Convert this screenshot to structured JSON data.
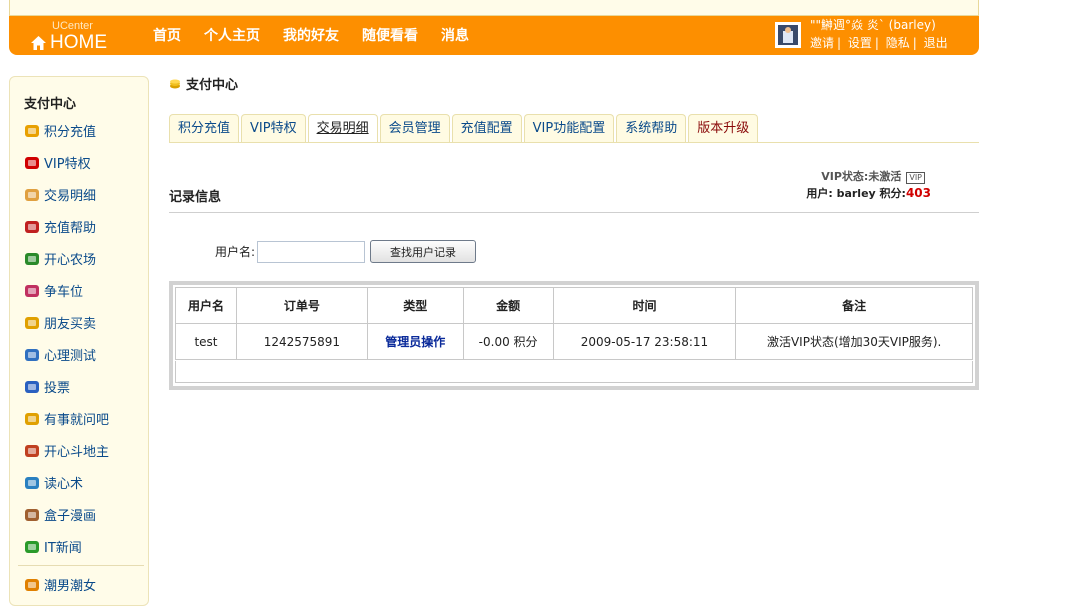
{
  "header": {
    "logo_top": "UCenter",
    "logo_main": "HOME",
    "nav": [
      "首页",
      "个人主页",
      "我的好友",
      "随便看看",
      "消息"
    ],
    "user_display": "\"\"鰰週°焱 炎` (barley)",
    "user_links": [
      "邀请",
      "设置",
      "隐私",
      "退出"
    ]
  },
  "sidebar": {
    "title": "支付中心",
    "items": [
      {
        "label": "积分充值",
        "icon": "coins-icon",
        "color": "#e8a000"
      },
      {
        "label": "VIP特权",
        "icon": "vip-icon",
        "color": "#d00000"
      },
      {
        "label": "交易明细",
        "icon": "list-icon",
        "color": "#e0a040"
      },
      {
        "label": "充值帮助",
        "icon": "help-icon",
        "color": "#c02020"
      },
      {
        "label": "开心农场",
        "icon": "sprout-icon",
        "color": "#2a8a2a"
      },
      {
        "label": "争车位",
        "icon": "car-icon",
        "color": "#c03060"
      },
      {
        "label": "朋友买卖",
        "icon": "money-icon",
        "color": "#e0a000"
      },
      {
        "label": "心理测试",
        "icon": "flask-icon",
        "color": "#3070c0"
      },
      {
        "label": "投票",
        "icon": "chart-icon",
        "color": "#2a60c0"
      },
      {
        "label": "有事就问吧",
        "icon": "question-icon",
        "color": "#e0a000"
      },
      {
        "label": "开心斗地主",
        "icon": "cards-icon",
        "color": "#c04020"
      },
      {
        "label": "读心术",
        "icon": "globe-icon",
        "color": "#2a80c0"
      },
      {
        "label": "盒子漫画",
        "icon": "box-icon",
        "color": "#a06030"
      },
      {
        "label": "IT新闻",
        "icon": "news-icon",
        "color": "#2a9a2a"
      },
      {
        "label": "潮男潮女",
        "icon": "people-icon",
        "color": "#e08000"
      }
    ]
  },
  "main": {
    "title": "支付中心",
    "tabs": [
      "积分充值",
      "VIP特权",
      "交易明细",
      "会员管理",
      "充值配置",
      "VIP功能配置",
      "系统帮助",
      "版本升级"
    ],
    "active_tab": "交易明细",
    "vip_status": "VIP状态:未激活",
    "vip_badge": "VIP",
    "user_label": "用户: barley 积分:",
    "user_score": "403",
    "section_title": "记录信息",
    "search_label": "用户名:",
    "search_value": "",
    "search_button": "查找用户记录",
    "table": {
      "headers": [
        "用户名",
        "订单号",
        "类型",
        "金额",
        "时间",
        "备注"
      ],
      "rows": [
        [
          "test",
          "1242575891",
          "管理员操作",
          "-0.00 积分",
          "2009-05-17 23:58:11",
          "激活VIP状态(增加30天VIP服务)."
        ]
      ]
    }
  },
  "colors": {
    "brand": "#fd8f00",
    "sidebar_bg": "#fffce9",
    "link": "#0a4a8a",
    "score": "#d00000"
  }
}
